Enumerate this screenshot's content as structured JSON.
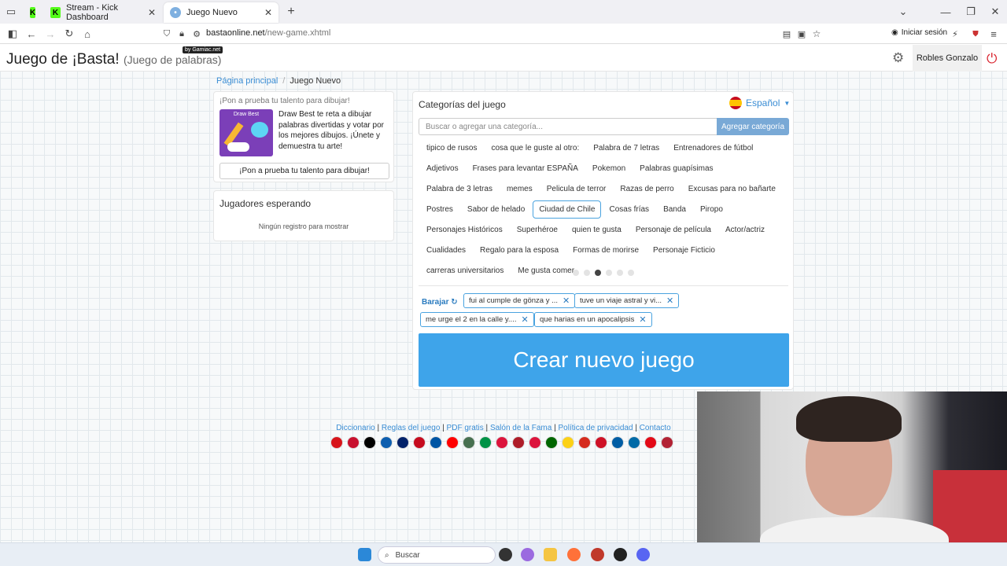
{
  "browser": {
    "tabs": [
      {
        "label": "Stream - Kick Dashboard",
        "active": false
      },
      {
        "label": "Juego Nuevo",
        "active": true
      }
    ],
    "url_host": "bastaonline.net",
    "url_path": "/new-game.xhtml",
    "signin_label": "Iniciar sesión",
    "ext_badge": "8"
  },
  "header": {
    "title": "Juego de ¡Basta!",
    "subtitle": "(Juego de palabras)",
    "badge": "by Gamiac.net",
    "user_name": "Robles Gonzalo"
  },
  "breadcrumb": {
    "home": "Página principal",
    "current": "Juego Nuevo"
  },
  "promo": {
    "title": "¡Pon a prueba tu talento para dibujar!",
    "image_label": "Draw Best",
    "text": "Draw Best te reta a dibujar palabras divertidas y votar por los mejores dibujos. ¡Únete y demuestra tu arte!",
    "button": "¡Pon a prueba tu talento para dibujar!"
  },
  "players": {
    "title": "Jugadores esperando",
    "empty": "Ningún registro para mostrar"
  },
  "categories": {
    "title": "Categorías del juego",
    "language": "Español",
    "search_placeholder": "Buscar o agregar una categoría...",
    "add_button": "Agregar categoría",
    "items": [
      "tipico de rusos",
      "cosa que le guste al otro:",
      "Palabra de 7 letras",
      "Entrenadores de fútbol",
      "Adjetivos",
      "Frases para levantar ESPAÑA",
      "Pokemon",
      "Palabras guapísimas",
      "Palabra de 3 letras",
      "memes",
      "Pelicula de terror",
      "Razas de perro",
      "Excusas para no bañarte",
      "Postres",
      "Sabor de helado",
      "Ciudad de Chile",
      "Cosas frías",
      "Banda",
      "Piropo",
      "Personajes Históricos",
      "Superhéroe",
      "quien te gusta",
      "Personaje de película",
      "Actor/actriz",
      "Cualidades",
      "Regalo para la esposa",
      "Formas de morirse",
      "Personaje Ficticio",
      "carreras universitarios",
      "Me gusta comer"
    ],
    "selected_item": "Ciudad de Chile",
    "page_dots": 6,
    "active_dot": 3
  },
  "selected": {
    "shuffle_label": "Barajar",
    "items": [
      "fui al cumple de gönza y ...",
      "tuve un viaje astral y vi...",
      "me urge el 2 en la calle y....",
      "que harias en un apocalipsis"
    ]
  },
  "create_button": "Crear nuevo juego",
  "footer": {
    "links": [
      "Diccionario",
      "Reglas del juego",
      "PDF gratis",
      "Salón de la Fama",
      "Política de privacidad",
      "Contacto"
    ],
    "flag_count": 21
  },
  "taskbar": {
    "search_placeholder": "Buscar"
  },
  "colors": {
    "accent": "#3ea4ea",
    "link": "#3a8dd4",
    "power": "#d9232e",
    "kick": "#53fc18"
  }
}
